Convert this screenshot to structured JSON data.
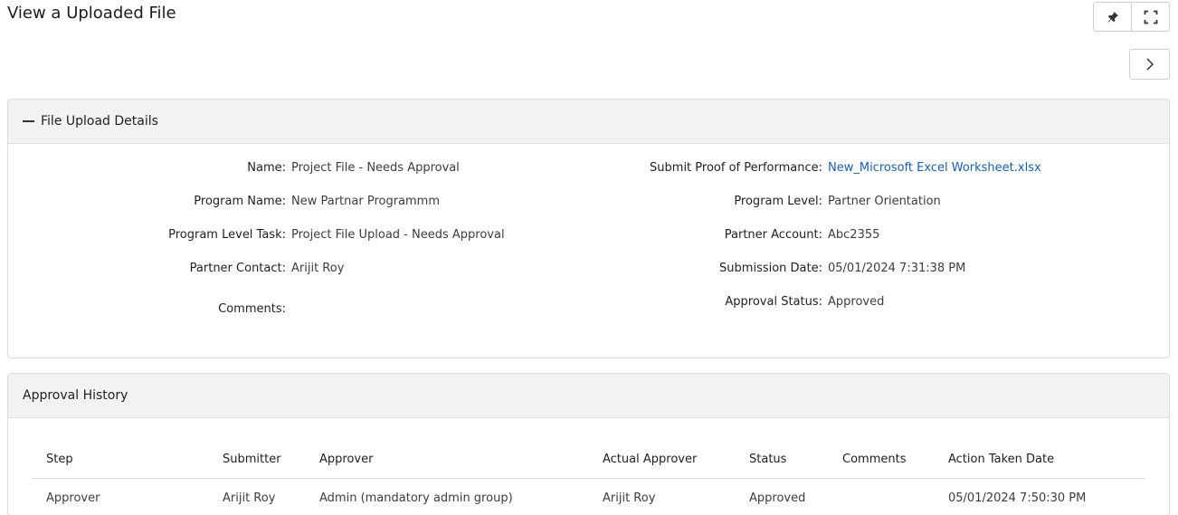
{
  "page": {
    "title": "View a Uploaded File"
  },
  "toolbar": {
    "pin_icon": "pin-icon",
    "fullscreen_icon": "expand-icon",
    "next_icon": "chevron-right-icon"
  },
  "details_panel": {
    "title": "File Upload Details",
    "left": [
      {
        "label": "Name:",
        "value": "Project File - Needs Approval"
      },
      {
        "label": "Program Name:",
        "value": "New Partnar Programmm"
      },
      {
        "label": "Program Level Task:",
        "value": "Project File Upload - Needs Approval"
      },
      {
        "label": "Partner Contact:",
        "value": "Arijit Roy"
      },
      {
        "label": "Comments:",
        "value": ""
      }
    ],
    "right": [
      {
        "label": "Submit Proof of Performance:",
        "value": "New_Microsoft Excel Worksheet.xlsx"
      },
      {
        "label": "Program Level:",
        "value": "Partner Orientation"
      },
      {
        "label": "Partner Account:",
        "value": "Abc2355"
      },
      {
        "label": "Submission Date:",
        "value": "05/01/2024 7:31:38 PM"
      },
      {
        "label": "Approval Status:",
        "value": "Approved"
      }
    ]
  },
  "history_panel": {
    "title": "Approval History",
    "columns": [
      "Step",
      "Submitter",
      "Approver",
      "Actual Approver",
      "Status",
      "Comments",
      "Action Taken Date"
    ],
    "rows": [
      [
        "Approver",
        "Arijit Roy",
        "Admin (mandatory admin group)",
        "Arijit Roy",
        "Approved",
        "",
        "05/01/2024 7:50:30 PM"
      ]
    ]
  },
  "colors": {
    "link": "#1f5fa6",
    "header_bg": "#f2f2f2",
    "border": "#dcdcdc"
  }
}
